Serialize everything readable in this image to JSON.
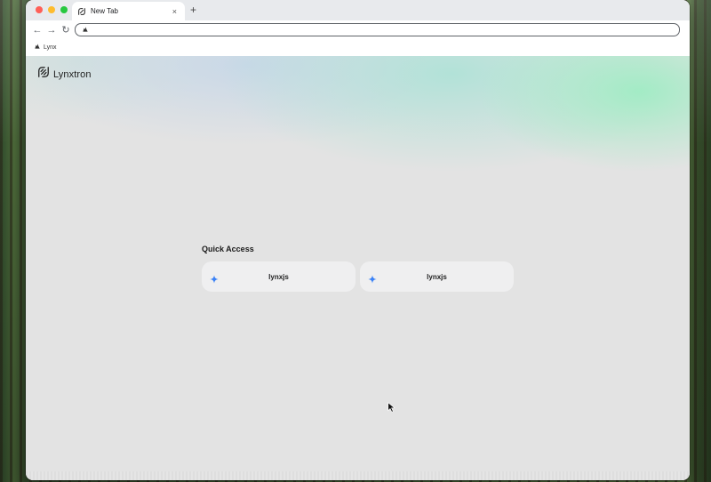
{
  "browser": {
    "tab": {
      "title": "New Tab",
      "close_glyph": "×"
    },
    "new_tab_glyph": "+",
    "nav": {
      "back_glyph": "←",
      "forward_glyph": "→",
      "reload_glyph": "↻"
    },
    "address_bar": {
      "value": "",
      "placeholder": ""
    },
    "bookmarks": [
      {
        "label": "Lynx",
        "icon": "lynx-icon"
      }
    ]
  },
  "page": {
    "brand": {
      "name": "Lynxtron",
      "icon": "lynxtron-logo-icon"
    },
    "quick_access": {
      "title": "Quick Access",
      "items": [
        {
          "label": "lynxjs",
          "icon": "sparkle-icon"
        },
        {
          "label": "lynxjs",
          "icon": "sparkle-icon"
        }
      ]
    }
  },
  "colors": {
    "sparkle": "#3b82f6",
    "traffic_red": "#ff5f57",
    "traffic_yellow": "#febc2e",
    "traffic_green": "#28c840"
  }
}
